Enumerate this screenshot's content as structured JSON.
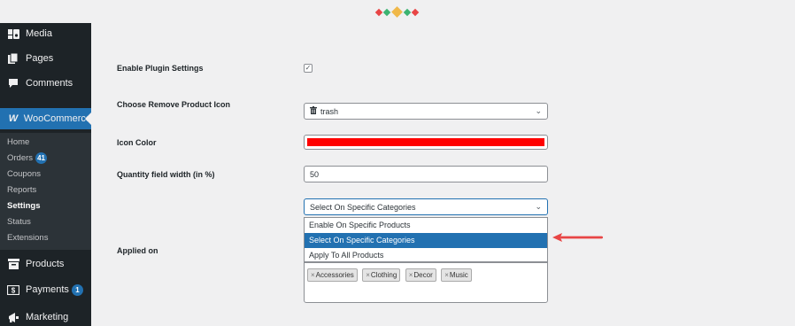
{
  "colors": {
    "accent": "#2271b1",
    "arrow": "#e84545",
    "icon_color": "#ff0000",
    "selected_option": "#2271b1"
  },
  "sidebar": {
    "top_items": [
      {
        "label": "Media",
        "icon": "media-icon"
      },
      {
        "label": "Pages",
        "icon": "pages-icon"
      },
      {
        "label": "Comments",
        "icon": "comments-icon"
      }
    ],
    "woocommerce": {
      "label": "WooCommerce",
      "icon_text": "W"
    },
    "submenu": [
      {
        "label": "Home"
      },
      {
        "label": "Orders",
        "badge": "41"
      },
      {
        "label": "Coupons"
      },
      {
        "label": "Reports"
      },
      {
        "label": "Settings"
      },
      {
        "label": "Status"
      },
      {
        "label": "Extensions"
      }
    ],
    "bottom_items": [
      {
        "label": "Products",
        "icon": "products-icon"
      },
      {
        "label": "Payments",
        "icon": "payments-icon",
        "badge": "1"
      },
      {
        "label": "Marketing",
        "icon": "marketing-icon"
      }
    ]
  },
  "settings": {
    "enable_plugin": {
      "label": "Enable Plugin Settings",
      "checked": true,
      "mark": "✓"
    },
    "remove_icon": {
      "label": "Choose Remove Product Icon",
      "value": "trash",
      "icon": "trash-icon"
    },
    "icon_color": {
      "label": "Icon Color"
    },
    "qty_width": {
      "label": "Quantity field width (in %)",
      "value": "50"
    },
    "applied_on": {
      "label": "Applied on",
      "selected": "Select On Specific Categories",
      "options": [
        "Enable On Specific Products",
        "Select On Specific Categories",
        "Apply To All Products"
      ],
      "tags": [
        "Accessories",
        "Clothing",
        "Decor",
        "Music"
      ]
    }
  }
}
